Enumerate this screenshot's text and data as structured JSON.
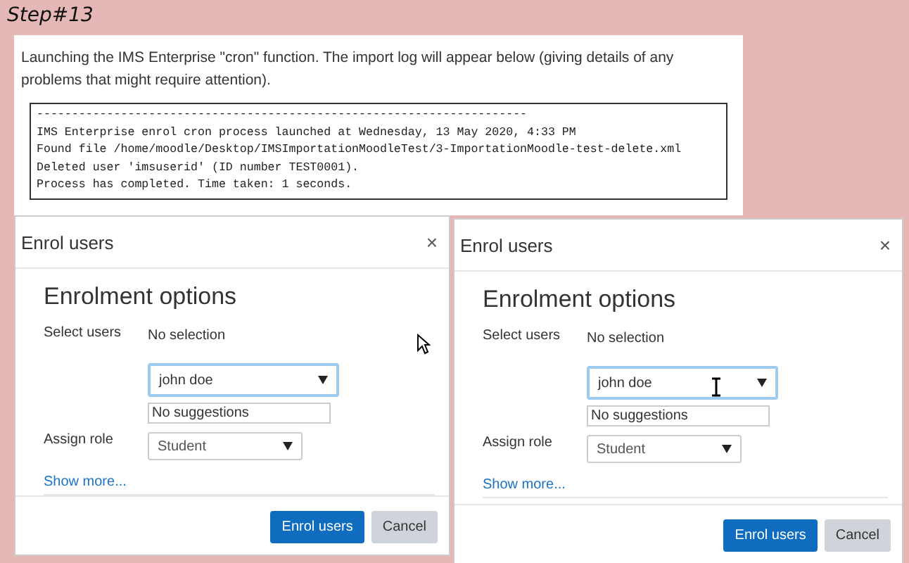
{
  "step_label": "Step#13",
  "intro": "Launching the IMS Enterprise \"cron\" function. The import log will appear below (giving details of any problems that might require attention).",
  "log_lines": [
    "----------------------------------------------------------------------",
    "IMS Enterprise enrol cron process launched at Wednesday, 13 May 2020, 4:33 PM",
    "Found file /home/moodle/Desktop/IMSImportationMoodleTest/3-ImportationMoodle-test-delete.xml",
    "Deleted user 'imsuserid' (ID number TEST0001).",
    "Process has completed. Time taken: 1 seconds."
  ],
  "dialogs": [
    {
      "title": "Enrol users",
      "close": "×",
      "heading": "Enrolment options",
      "select_label": "Select users",
      "selection": "No selection",
      "search_value": "john doe",
      "suggestions": "No suggestions",
      "role_label": "Assign role",
      "role": "Student",
      "show_more": "Show more...",
      "buttons": [
        {
          "label": "Enrol users",
          "kind": "primary"
        },
        {
          "label": "Cancel",
          "kind": "secondary"
        }
      ]
    },
    {
      "title": "Enrol users",
      "close": "×",
      "heading": "Enrolment options",
      "select_label": "Select users",
      "selection": "No selection",
      "search_value": "john doe",
      "suggestions": "No suggestions",
      "role_label": "Assign role",
      "role": "Student",
      "show_more": "Show more...",
      "buttons": [
        {
          "label": "Enrol users",
          "kind": "primary"
        },
        {
          "label": "Cancel",
          "kind": "secondary"
        }
      ]
    }
  ]
}
